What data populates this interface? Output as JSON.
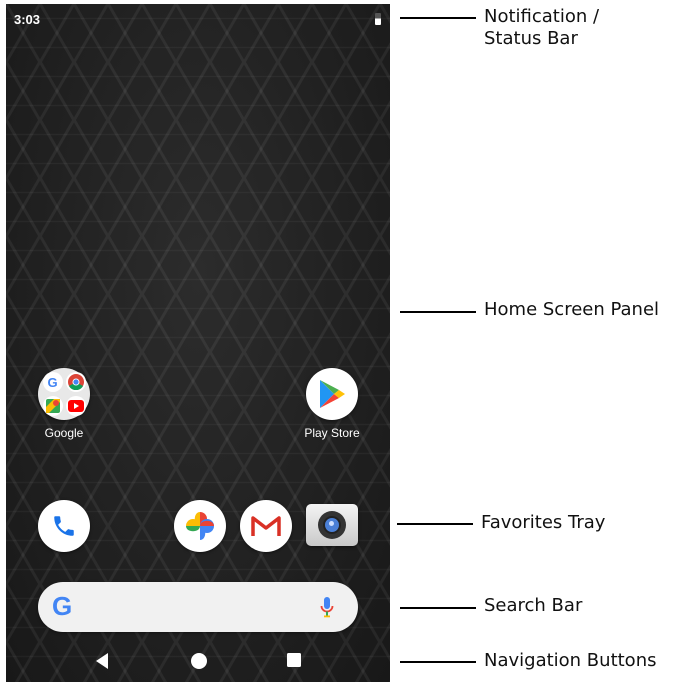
{
  "status_bar": {
    "time": "3:03"
  },
  "apps": {
    "google": {
      "label": "Google"
    },
    "play_store": {
      "label": "Play Store"
    }
  },
  "favorites": [
    "phone-icon",
    "photos-icon",
    "gmail-icon",
    "camera-icon"
  ],
  "search_bar": {
    "logo": "G"
  },
  "nav_buttons": [
    "back-icon",
    "home-icon",
    "recents-icon"
  ],
  "callouts": {
    "status_bar": "Notification /\nStatus Bar",
    "home_panel": "Home Screen Panel",
    "favorites_tray": "Favorites Tray",
    "search_bar": "Search Bar",
    "navigation_buttons": "Navigation Buttons"
  },
  "colors": {
    "google_blue": "#4285F4",
    "google_red": "#EA4335",
    "google_yellow": "#FBBC05",
    "google_green": "#34A853"
  }
}
